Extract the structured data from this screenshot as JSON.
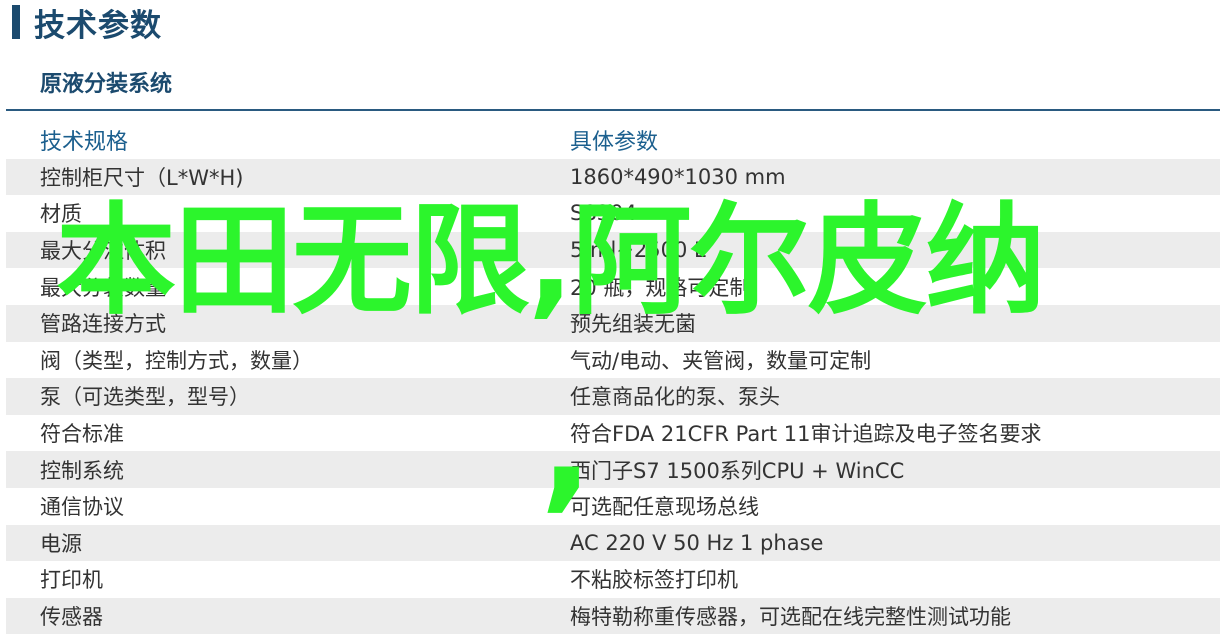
{
  "page": {
    "title": "技术参数"
  },
  "section": {
    "title": "原液分装系统"
  },
  "table": {
    "headers": [
      "技术规格",
      "具体参数"
    ],
    "rows": [
      [
        "控制柜尺寸（L*W*H)",
        "1860*490*1030 mm"
      ],
      [
        "材质",
        "SS304"
      ],
      [
        "最大分注体积",
        "5 ml~2500 L"
      ],
      [
        "最大分装数量",
        "20 瓶，规格可定制"
      ],
      [
        "管路连接方式",
        "预先组装无菌"
      ],
      [
        "阀（类型，控制方式，数量）",
        "气动/电动、夹管阀，数量可定制"
      ],
      [
        "泵（可选类型，型号）",
        "任意商品化的泵、泵头"
      ],
      [
        "符合标准",
        "符合FDA 21CFR Part 11审计追踪及电子签名要求"
      ],
      [
        "控制系统",
        "西门子S7 1500系列CPU + WinCC"
      ],
      [
        "通信协议",
        "可选配任意现场总线"
      ],
      [
        "电源",
        "AC 220 V 50 Hz 1 phase"
      ],
      [
        "打印机",
        "不粘胶标签打印机"
      ],
      [
        "传感器",
        "梅特勒称重传感器，可选配在线完整性测试功能"
      ]
    ]
  },
  "overlay": {
    "text": "本田无限,阿尔皮纳",
    "second_comma": ",",
    "color": "#2cf52c"
  }
}
